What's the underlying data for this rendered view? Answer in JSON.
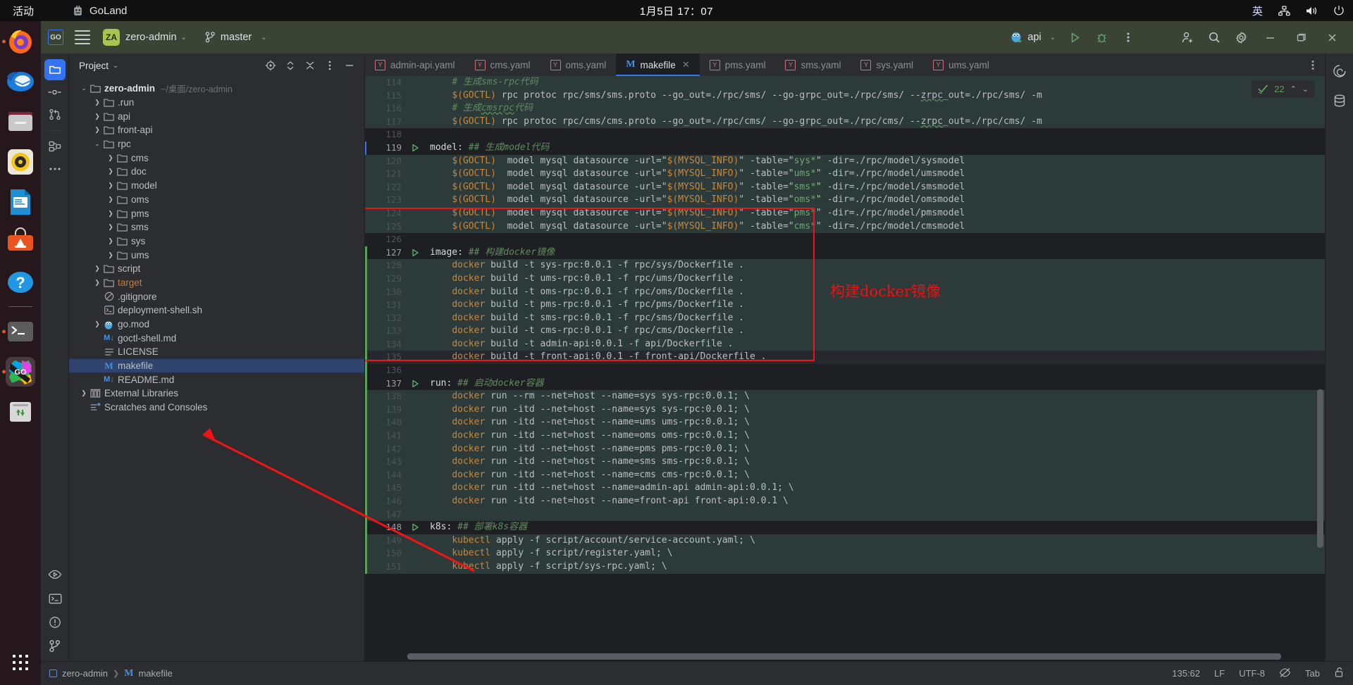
{
  "gnome": {
    "activities": "活动",
    "app_name": "GoLand",
    "clock": "1月5日 17：07",
    "ime": "英",
    "icons": [
      "network-icon",
      "volume-icon",
      "power-icon"
    ]
  },
  "dock": {
    "items": [
      {
        "name": "firefox",
        "running": true
      },
      {
        "name": "thunderbird",
        "running": false
      },
      {
        "name": "files",
        "running": false
      },
      {
        "name": "rhythmbox",
        "running": false
      },
      {
        "name": "libreoffice-writer",
        "running": false
      },
      {
        "name": "ubuntu-software",
        "running": false
      },
      {
        "name": "help",
        "running": false
      },
      {
        "name": "terminal",
        "running": true
      },
      {
        "name": "goland",
        "running": true
      },
      {
        "name": "trash",
        "running": false
      }
    ],
    "show_apps": "show-applications"
  },
  "toolbar": {
    "logo": "GO",
    "menu": "main-menu",
    "project_badge": "ZA",
    "project_name": "zero-admin",
    "branch": "master",
    "run_config": "api",
    "run_label": "run-button",
    "debug_label": "debug-button",
    "more_label": "more-actions",
    "account": "account-button",
    "search": "search-button",
    "settings": "settings-button",
    "minimize": "—",
    "maximize": "maximize",
    "close": "✕"
  },
  "tool_strip_left": {
    "items": [
      "project-icon",
      "commit-icon",
      "pull-requests-icon",
      "structure-icon",
      "more-tool-windows-icon"
    ],
    "bottom": [
      "run-icon",
      "terminal-icon",
      "problems-icon",
      "git-icon"
    ]
  },
  "tool_strip_right": {
    "items": [
      "ai-assistant-icon",
      "database-icon"
    ]
  },
  "project_panel": {
    "title": "Project",
    "actions": [
      "select-opened-file-icon",
      "expand-collapse-icon",
      "collapse-all-icon",
      "options-icon",
      "hide-icon"
    ],
    "tree": [
      {
        "depth": 0,
        "arrow": "down",
        "icon": "folder",
        "label": "zero-admin",
        "bold": true,
        "path": "~/桌面/zero-admin"
      },
      {
        "depth": 1,
        "arrow": "right",
        "icon": "folder",
        "label": ".run"
      },
      {
        "depth": 1,
        "arrow": "right",
        "icon": "folder",
        "label": "api"
      },
      {
        "depth": 1,
        "arrow": "right",
        "icon": "folder",
        "label": "front-api"
      },
      {
        "depth": 1,
        "arrow": "down",
        "icon": "folder",
        "label": "rpc"
      },
      {
        "depth": 2,
        "arrow": "right",
        "icon": "folder",
        "label": "cms"
      },
      {
        "depth": 2,
        "arrow": "right",
        "icon": "folder",
        "label": "doc"
      },
      {
        "depth": 2,
        "arrow": "right",
        "icon": "folder",
        "label": "model"
      },
      {
        "depth": 2,
        "arrow": "right",
        "icon": "folder",
        "label": "oms"
      },
      {
        "depth": 2,
        "arrow": "right",
        "icon": "folder",
        "label": "pms"
      },
      {
        "depth": 2,
        "arrow": "right",
        "icon": "folder",
        "label": "sms"
      },
      {
        "depth": 2,
        "arrow": "right",
        "icon": "folder",
        "label": "sys"
      },
      {
        "depth": 2,
        "arrow": "right",
        "icon": "folder",
        "label": "ums"
      },
      {
        "depth": 1,
        "arrow": "right",
        "icon": "folder",
        "label": "script"
      },
      {
        "depth": 1,
        "arrow": "right",
        "icon": "folder",
        "label": "target",
        "color": "orange"
      },
      {
        "depth": 1,
        "arrow": "none",
        "icon": "gitignore",
        "label": ".gitignore"
      },
      {
        "depth": 1,
        "arrow": "none",
        "icon": "shell",
        "label": "deployment-shell.sh"
      },
      {
        "depth": 1,
        "arrow": "right",
        "icon": "gomod",
        "label": "go.mod"
      },
      {
        "depth": 1,
        "arrow": "none",
        "icon": "md",
        "label": "goctl-shell.md"
      },
      {
        "depth": 1,
        "arrow": "none",
        "icon": "text",
        "label": "LICENSE"
      },
      {
        "depth": 1,
        "arrow": "none",
        "icon": "makefile",
        "label": "makefile",
        "selected": true
      },
      {
        "depth": 1,
        "arrow": "none",
        "icon": "md",
        "label": "README.md"
      },
      {
        "depth": 0,
        "arrow": "right",
        "icon": "libs",
        "label": "External Libraries"
      },
      {
        "depth": 0,
        "arrow": "none",
        "icon": "scratch",
        "label": "Scratches and Consoles"
      }
    ]
  },
  "editor": {
    "tabs": [
      {
        "label": "admin-api.yaml",
        "icon": "yaml",
        "active": false
      },
      {
        "label": "cms.yaml",
        "icon": "yaml",
        "active": false
      },
      {
        "label": "oms.yaml",
        "icon": "yaml",
        "active": false
      },
      {
        "label": "makefile",
        "icon": "makefile",
        "active": true,
        "close": "✕"
      },
      {
        "label": "pms.yaml",
        "icon": "yaml",
        "active": false
      },
      {
        "label": "sms.yaml",
        "icon": "yaml",
        "active": false
      },
      {
        "label": "sys.yaml",
        "icon": "yaml",
        "active": false
      },
      {
        "label": "ums.yaml",
        "icon": "yaml",
        "active": false
      }
    ],
    "tabs_more": "more-tabs-icon",
    "inspections": {
      "count": "22",
      "up": "⌃",
      "down": "⌄",
      "status": "check-ok-icon"
    },
    "lines": [
      {
        "n": "114",
        "hl": true,
        "run": false,
        "html": "    <span class='k-cmt'># 生成sms-rpc代码</span>"
      },
      {
        "n": "115",
        "hl": true,
        "run": false,
        "html": "    <span class='k-var'>$(GOCTL)</span><span class='k-txt'> rpc protoc rpc/sms/sms.proto --go_out=./rpc/sms/ --go-grpc_out=./rpc/sms/ --</span><span class='k-txt sq'>zrpc</span><span class='k-txt'>_out=./rpc/sms/ -m</span>"
      },
      {
        "n": "116",
        "hl": true,
        "run": false,
        "html": "    <span class='k-cmt'># 生成</span><span class='k-cmt sq'>cmsrpc</span><span class='k-cmt'>代码</span>"
      },
      {
        "n": "117",
        "hl": true,
        "run": false,
        "html": "    <span class='k-var'>$(GOCTL)</span><span class='k-txt'> rpc protoc rpc/cms/cms.proto --go_out=./rpc/cms/ --go-grpc_out=./rpc/cms/ --</span><span class='k-txt sq'>zrpc</span><span class='k-txt'>_out=./rpc/cms/ -m</span>"
      },
      {
        "n": "118",
        "hl": false,
        "run": false,
        "html": ""
      },
      {
        "n": "119",
        "hl": false,
        "run": true,
        "blue": true,
        "html": "<span class='k-tgt'>model:</span> <span class='k-cmt'>## 生成model代码</span>"
      },
      {
        "n": "120",
        "hl": true,
        "run": false,
        "html": "    <span class='k-var'>$(GOCTL)</span><span class='k-txt'>  model mysql datasource -url=\"</span><span class='k-var'>$(MYSQL_INFO)</span><span class='k-txt'>\" -table=\"</span><span class='k-str'>sys*</span><span class='k-txt'>\" -dir=./rpc/model/sysmodel</span>"
      },
      {
        "n": "121",
        "hl": true,
        "run": false,
        "html": "    <span class='k-var'>$(GOCTL)</span><span class='k-txt'>  model mysql datasource -url=\"</span><span class='k-var'>$(MYSQL_INFO)</span><span class='k-txt'>\" -table=\"</span><span class='k-str'>ums*</span><span class='k-txt'>\" -dir=./rpc/model/umsmodel</span>"
      },
      {
        "n": "122",
        "hl": true,
        "run": false,
        "html": "    <span class='k-var'>$(GOCTL)</span><span class='k-txt'>  model mysql datasource -url=\"</span><span class='k-var'>$(MYSQL_INFO)</span><span class='k-txt'>\" -table=\"</span><span class='k-str'>sms*</span><span class='k-txt'>\" -dir=./rpc/model/smsmodel</span>"
      },
      {
        "n": "123",
        "hl": true,
        "run": false,
        "html": "    <span class='k-var'>$(GOCTL)</span><span class='k-txt'>  model mysql datasource -url=\"</span><span class='k-var'>$(MYSQL_INFO)</span><span class='k-txt'>\" -table=\"</span><span class='k-str'>oms*</span><span class='k-txt'>\" -dir=./rpc/model/omsmodel</span>"
      },
      {
        "n": "124",
        "hl": true,
        "run": false,
        "html": "    <span class='k-var'>$(GOCTL)</span><span class='k-txt'>  model mysql datasource -url=\"</span><span class='k-var'>$(MYSQL_INFO)</span><span class='k-txt'>\" -table=\"</span><span class='k-str'>pms*</span><span class='k-txt'>\" -dir=./rpc/model/pmsmodel</span>"
      },
      {
        "n": "125",
        "hl": true,
        "run": false,
        "html": "    <span class='k-var'>$(GOCTL)</span><span class='k-txt'>  model mysql datasource -url=\"</span><span class='k-var'>$(MYSQL_INFO)</span><span class='k-txt'>\" -table=\"</span><span class='k-str'>cms*</span><span class='k-txt'>\" -dir=./rpc/model/cmsmodel</span>"
      },
      {
        "n": "126",
        "hl": false,
        "run": false,
        "html": ""
      },
      {
        "n": "127",
        "hl": false,
        "run": true,
        "green": true,
        "html": "<span class='k-tgt'>image:</span> <span class='k-cmt'>## 构建docker镜像</span>"
      },
      {
        "n": "128",
        "hl": true,
        "run": false,
        "green": true,
        "html": "    <span class='k-cmd'>docker</span><span class='k-txt'> build -t sys-rpc:0.0.1 -f rpc/sys/Dockerfile .</span>"
      },
      {
        "n": "129",
        "hl": true,
        "run": false,
        "green": true,
        "html": "    <span class='k-cmd'>docker</span><span class='k-txt'> build -t ums-rpc:0.0.1 -f rpc/ums/Dockerfile .</span>"
      },
      {
        "n": "130",
        "hl": true,
        "run": false,
        "green": true,
        "html": "    <span class='k-cmd'>docker</span><span class='k-txt'> build -t oms-rpc:0.0.1 -f rpc/oms/Dockerfile .</span>"
      },
      {
        "n": "131",
        "hl": true,
        "run": false,
        "green": true,
        "html": "    <span class='k-cmd'>docker</span><span class='k-txt'> build -t pms-rpc:0.0.1 -f rpc/pms/Dockerfile .</span>"
      },
      {
        "n": "132",
        "hl": true,
        "run": false,
        "green": true,
        "html": "    <span class='k-cmd'>docker</span><span class='k-txt'> build -t sms-rpc:0.0.1 -f rpc/sms/Dockerfile .</span>"
      },
      {
        "n": "133",
        "hl": true,
        "run": false,
        "green": true,
        "html": "    <span class='k-cmd'>docker</span><span class='k-txt'> build -t cms-rpc:0.0.1 -f rpc/cms/Dockerfile .</span>"
      },
      {
        "n": "134",
        "hl": true,
        "run": false,
        "green": true,
        "html": "    <span class='k-cmd'>docker</span><span class='k-txt'> build -t admin-api:0.0.1 -f api/Dockerfile .</span>"
      },
      {
        "n": "135",
        "hl": true,
        "run": false,
        "green": true,
        "cur": true,
        "html": "    <span class='k-cmd'>docker</span><span class='k-txt'> build -t front-api:0.0.1 -f front-api/Dockerfile .</span>"
      },
      {
        "n": "136",
        "hl": false,
        "run": false,
        "green": true,
        "html": ""
      },
      {
        "n": "137",
        "hl": false,
        "run": true,
        "green": true,
        "html": "<span class='k-tgt'>run:</span> <span class='k-cmt'>## 启动docker容器</span>"
      },
      {
        "n": "138",
        "hl": true,
        "run": false,
        "green": true,
        "html": "    <span class='k-cmd'>docker</span><span class='k-txt'> run --rm --net=host --name=sys sys-rpc:0.0.1; \\</span>"
      },
      {
        "n": "139",
        "hl": true,
        "run": false,
        "green": true,
        "html": "    <span class='k-cmd'>docker</span><span class='k-txt'> run -itd --net=host --name=sys sys-rpc:0.0.1; \\</span>"
      },
      {
        "n": "140",
        "hl": true,
        "run": false,
        "green": true,
        "html": "    <span class='k-cmd'>docker</span><span class='k-txt'> run -itd --net=host --name=ums ums-rpc:0.0.1; \\</span>"
      },
      {
        "n": "141",
        "hl": true,
        "run": false,
        "green": true,
        "html": "    <span class='k-cmd'>docker</span><span class='k-txt'> run -itd --net=host --name=oms oms-rpc:0.0.1; \\</span>"
      },
      {
        "n": "142",
        "hl": true,
        "run": false,
        "green": true,
        "html": "    <span class='k-cmd'>docker</span><span class='k-txt'> run -itd --net=host --name=pms pms-rpc:0.0.1; \\</span>"
      },
      {
        "n": "143",
        "hl": true,
        "run": false,
        "green": true,
        "html": "    <span class='k-cmd'>docker</span><span class='k-txt'> run -itd --net=host --name=sms sms-rpc:0.0.1; \\</span>"
      },
      {
        "n": "144",
        "hl": true,
        "run": false,
        "green": true,
        "html": "    <span class='k-cmd'>docker</span><span class='k-txt'> run -itd --net=host --name=cms cms-rpc:0.0.1; \\</span>"
      },
      {
        "n": "145",
        "hl": true,
        "run": false,
        "green": true,
        "html": "    <span class='k-cmd'>docker</span><span class='k-txt'> run -itd --net=host --name=admin-api admin-api:0.0.1; \\</span>"
      },
      {
        "n": "146",
        "hl": true,
        "run": false,
        "green": true,
        "html": "    <span class='k-cmd'>docker</span><span class='k-txt'> run -itd --net=host --name=front-api front-api:0.0.1 \\</span>"
      },
      {
        "n": "147",
        "hl": true,
        "run": false,
        "green": true,
        "html": ""
      },
      {
        "n": "148",
        "hl": false,
        "run": true,
        "green": true,
        "html": "<span class='k-tgt'>k8s:</span> <span class='k-cmt'>## 部署k8s容器</span>"
      },
      {
        "n": "149",
        "hl": true,
        "run": false,
        "green": true,
        "html": "    <span class='k-cmd'>kubectl</span><span class='k-txt'> apply -f script/account/service-account.yaml; \\</span>"
      },
      {
        "n": "150",
        "hl": true,
        "run": false,
        "green": true,
        "html": "    <span class='k-cmd'>kubectl</span><span class='k-txt'> apply -f script/register.yaml; \\</span>"
      },
      {
        "n": "151",
        "hl": true,
        "run": false,
        "green": true,
        "html": "    <span class='k-cmd'>kubectl</span><span class='k-txt'> apply -f script/sys-rpc.yaml; \\</span>"
      }
    ]
  },
  "annotation": {
    "label": "构建docker镜像",
    "color": "#ee1111"
  },
  "statusbar": {
    "breadcrumb_project": "zero-admin",
    "breadcrumb_sep": "❯",
    "breadcrumb_file": "makefile",
    "position": "135:62",
    "line_ending": "LF",
    "encoding": "UTF-8",
    "indent": "Tab",
    "readonly_icon": "lock-open-icon",
    "inspection_icon": "inspections-off-icon"
  }
}
